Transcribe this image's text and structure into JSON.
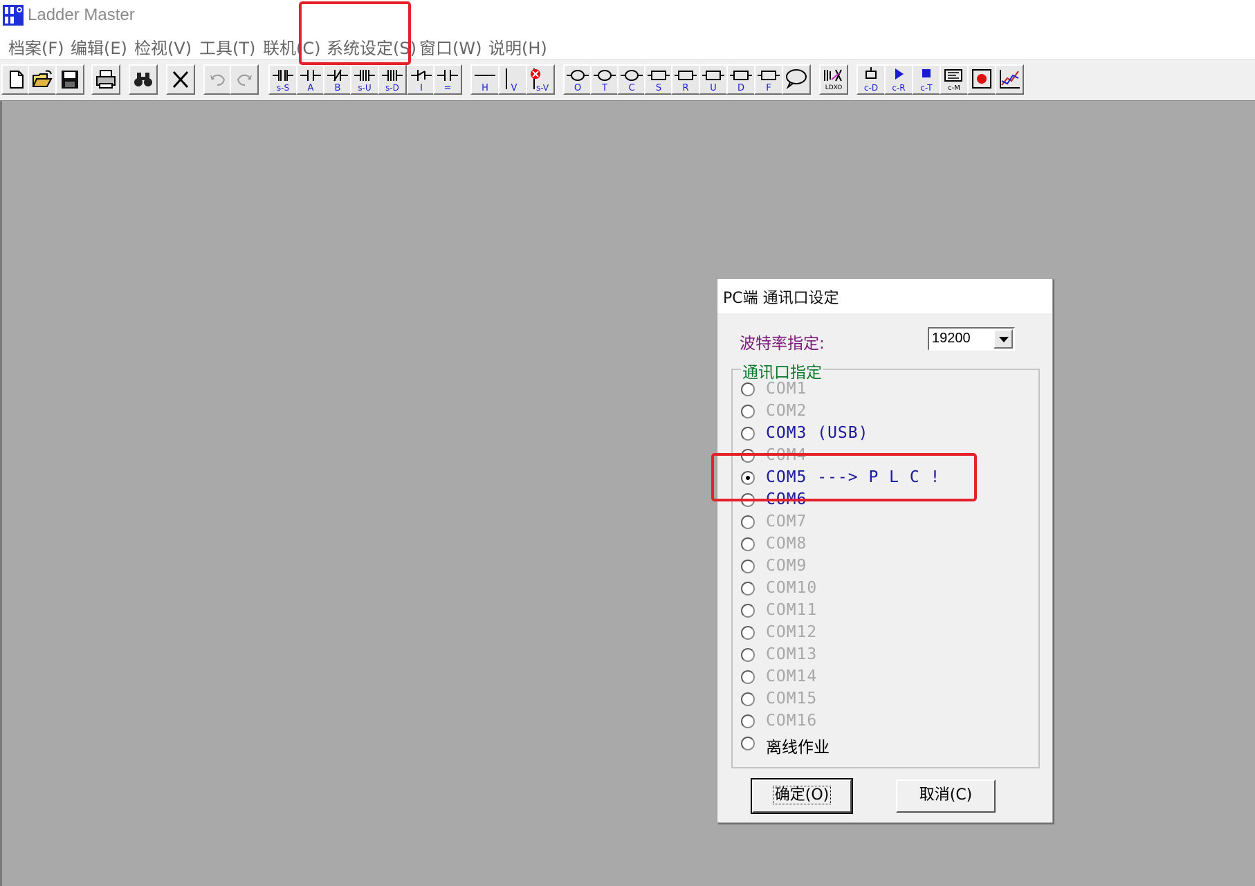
{
  "app": {
    "title": "Ladder Master"
  },
  "menu": [
    "档案(F)",
    "编辑(E)",
    "检视(V)",
    "工具(T)",
    "联机(C)",
    "系统设定(S)",
    "窗口(W)",
    "说明(H)"
  ],
  "toolbar": {
    "icons": [
      "new-file-icon",
      "open-folder-icon",
      "save-icon",
      "print-icon",
      "find-icon",
      "delete-icon",
      "undo-icon",
      "redo-icon",
      "contact-s-s-icon",
      "contact-a-icon",
      "contact-b-icon",
      "contact-s-u-icon",
      "contact-s-d-icon",
      "contact-i-icon",
      "contact-eq-icon",
      "hline-icon",
      "vline-icon",
      "delete-vline-icon",
      "coil-o-icon",
      "coil-t-icon",
      "coil-c-icon",
      "coil-s-icon",
      "coil-r-icon",
      "coil-u-icon",
      "coil-d-icon",
      "coil-f-icon",
      "comment-icon",
      "ldxo-icon",
      "c-d-icon",
      "c-r-icon",
      "c-t-icon",
      "c-m-icon",
      "record-icon",
      "chart-icon"
    ],
    "labels": {
      "s_s": "s-S",
      "a": "A",
      "b": "B",
      "s_u": "s-U",
      "s_d": "s-D",
      "i": "I",
      "eq": "=",
      "h": "H",
      "v": "V",
      "s_v": "s-V",
      "o": "O",
      "t": "T",
      "c": "C",
      "s": "S",
      "r": "R",
      "u": "U",
      "d": "D",
      "f": "F",
      "ldxo": "LDXO",
      "c_d": "c-D",
      "c_r": "c-R",
      "c_t": "c-T",
      "c_m": "c-M"
    }
  },
  "dialog": {
    "title": "PC端 通讯口设定",
    "baud_label": "波特率指定:",
    "baud_value": "19200",
    "group_label": "通讯口指定",
    "ports": [
      {
        "label": "COM1",
        "state": "disabled",
        "checked": false
      },
      {
        "label": "COM2",
        "state": "disabled",
        "checked": false
      },
      {
        "label": "COM3 (USB)",
        "state": "enabled",
        "checked": false
      },
      {
        "label": "COM4",
        "state": "disabled",
        "checked": false
      },
      {
        "label": "COM5 ---> P L C !",
        "state": "enabled",
        "checked": true
      },
      {
        "label": "COM6",
        "state": "enabled",
        "checked": false
      },
      {
        "label": "COM7",
        "state": "disabled",
        "checked": false
      },
      {
        "label": "COM8",
        "state": "disabled",
        "checked": false
      },
      {
        "label": "COM9",
        "state": "disabled",
        "checked": false
      },
      {
        "label": "COM10",
        "state": "disabled",
        "checked": false
      },
      {
        "label": "COM11",
        "state": "disabled",
        "checked": false
      },
      {
        "label": "COM12",
        "state": "disabled",
        "checked": false
      },
      {
        "label": "COM13",
        "state": "disabled",
        "checked": false
      },
      {
        "label": "COM14",
        "state": "disabled",
        "checked": false
      },
      {
        "label": "COM15",
        "state": "disabled",
        "checked": false
      },
      {
        "label": "COM16",
        "state": "disabled",
        "checked": false
      },
      {
        "label": "离线作业",
        "state": "offline",
        "checked": false
      }
    ],
    "ok_label": "确定(O)",
    "cancel_label": "取消(C)"
  },
  "colors": {
    "highlight": "#e5212a",
    "workspace": "#a9a9a9",
    "baud_label": "#7a1a7a",
    "group_label": "#0a7a2a",
    "port_enabled": "#1a1a9a"
  }
}
